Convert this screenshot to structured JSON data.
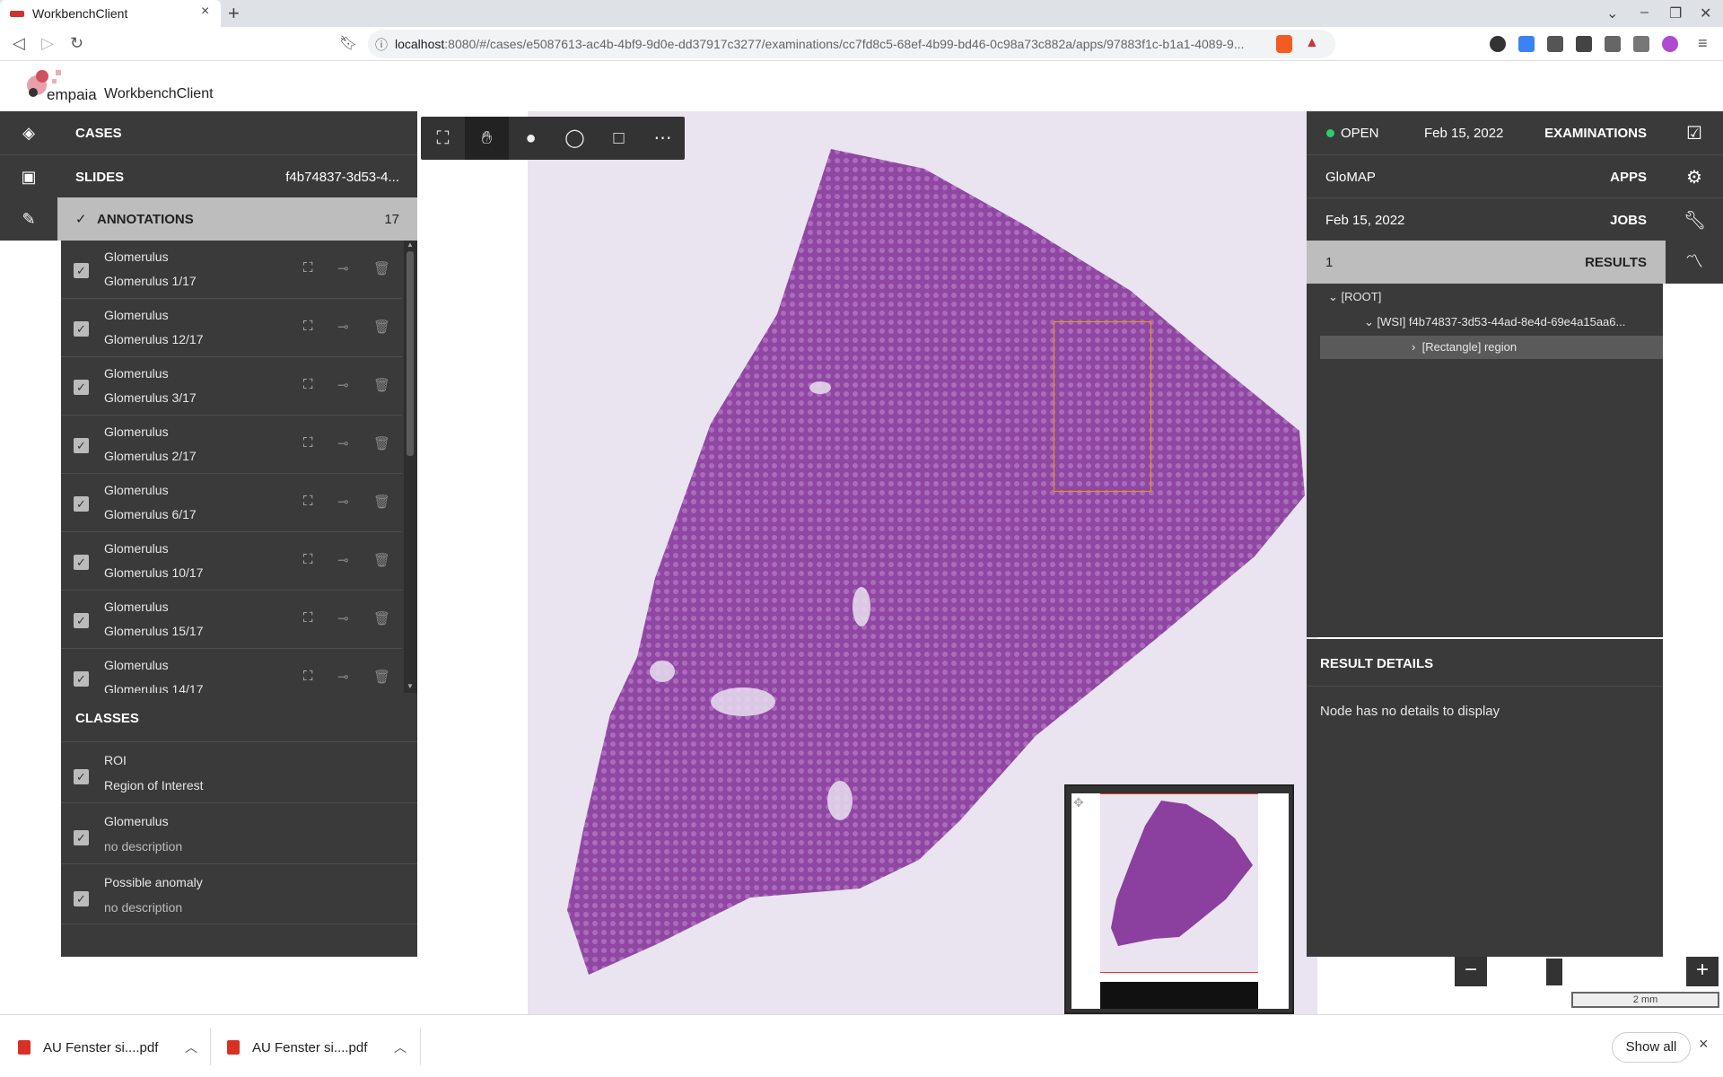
{
  "browser": {
    "tab_title": "WorkbenchClient",
    "tab_close": "×",
    "new_tab": "+",
    "url_host": "localhost",
    "url_path": ":8080/#/cases/e5087613-ac4b-4bf9-9d0e-dd37917c3277/examinations/cc7fd8c5-68ef-4b99-bd46-0c98a73c882a/apps/97883f1c-b1a1-4089-9..."
  },
  "app": {
    "logo_text": "empaia",
    "title": "WorkbenchClient"
  },
  "left_nav": {
    "cases_label": "CASES",
    "slides_label": "SLIDES",
    "slides_value": "f4b74837-3d53-4...",
    "annotations_label": "ANNOTATIONS",
    "annotations_check": "✓",
    "annotations_count": "17"
  },
  "annotations": [
    {
      "class": "Glomerulus",
      "name": "Glomerulus 1/17"
    },
    {
      "class": "Glomerulus",
      "name": "Glomerulus 12/17"
    },
    {
      "class": "Glomerulus",
      "name": "Glomerulus 3/17"
    },
    {
      "class": "Glomerulus",
      "name": "Glomerulus 2/17"
    },
    {
      "class": "Glomerulus",
      "name": "Glomerulus 6/17"
    },
    {
      "class": "Glomerulus",
      "name": "Glomerulus 10/17"
    },
    {
      "class": "Glomerulus",
      "name": "Glomerulus 15/17"
    },
    {
      "class": "Glomerulus",
      "name": "Glomerulus 14/17"
    }
  ],
  "classes": {
    "header": "CLASSES",
    "items": [
      {
        "name": "ROI",
        "desc": "Region of Interest"
      },
      {
        "name": "Glomerulus",
        "desc": "no description"
      },
      {
        "name": "Possible anomaly",
        "desc": "no description"
      }
    ]
  },
  "right_panel": {
    "status": "OPEN",
    "exam_date": "Feb 15, 2022",
    "examinations_label": "EXAMINATIONS",
    "app_name": "GloMAP",
    "apps_label": "APPS",
    "job_date": "Feb 15, 2022",
    "jobs_label": "JOBS",
    "results_count": "1",
    "results_label": "RESULTS"
  },
  "tree": {
    "root": "[ROOT]",
    "wsi": "[WSI] f4b74837-3d53-44ad-8e4d-69e4a15aa6...",
    "region": "[Rectangle] region"
  },
  "result_details": {
    "header": "RESULT DETAILS",
    "message": "Node has no details to display"
  },
  "viewer": {
    "scale_label": "2 mm",
    "zoom_minus": "−",
    "zoom_plus": "+"
  },
  "downloads": {
    "items": [
      "AU Fenster si....pdf",
      "AU Fenster si....pdf"
    ],
    "show_all": "Show all",
    "close": "×"
  },
  "colors": {
    "panel": "#3a3a3a",
    "selected_nav": "#bdbdbd",
    "status_open": "#2ecc71",
    "roi_box": "#e0a000",
    "tissue": "#8a3e9e"
  }
}
